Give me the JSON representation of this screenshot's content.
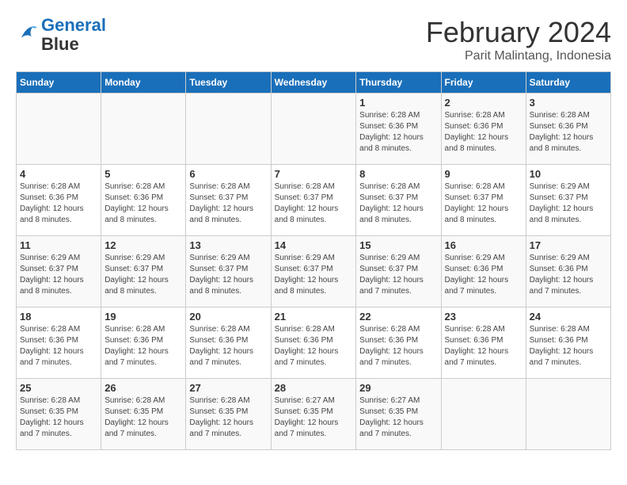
{
  "logo": {
    "line1": "General",
    "line2": "Blue"
  },
  "title": "February 2024",
  "subtitle": "Parit Malintang, Indonesia",
  "weekdays": [
    "Sunday",
    "Monday",
    "Tuesday",
    "Wednesday",
    "Thursday",
    "Friday",
    "Saturday"
  ],
  "weeks": [
    [
      {
        "day": "",
        "info": ""
      },
      {
        "day": "",
        "info": ""
      },
      {
        "day": "",
        "info": ""
      },
      {
        "day": "",
        "info": ""
      },
      {
        "day": "1",
        "info": "Sunrise: 6:28 AM\nSunset: 6:36 PM\nDaylight: 12 hours and 8 minutes."
      },
      {
        "day": "2",
        "info": "Sunrise: 6:28 AM\nSunset: 6:36 PM\nDaylight: 12 hours and 8 minutes."
      },
      {
        "day": "3",
        "info": "Sunrise: 6:28 AM\nSunset: 6:36 PM\nDaylight: 12 hours and 8 minutes."
      }
    ],
    [
      {
        "day": "4",
        "info": "Sunrise: 6:28 AM\nSunset: 6:36 PM\nDaylight: 12 hours and 8 minutes."
      },
      {
        "day": "5",
        "info": "Sunrise: 6:28 AM\nSunset: 6:36 PM\nDaylight: 12 hours and 8 minutes."
      },
      {
        "day": "6",
        "info": "Sunrise: 6:28 AM\nSunset: 6:37 PM\nDaylight: 12 hours and 8 minutes."
      },
      {
        "day": "7",
        "info": "Sunrise: 6:28 AM\nSunset: 6:37 PM\nDaylight: 12 hours and 8 minutes."
      },
      {
        "day": "8",
        "info": "Sunrise: 6:28 AM\nSunset: 6:37 PM\nDaylight: 12 hours and 8 minutes."
      },
      {
        "day": "9",
        "info": "Sunrise: 6:28 AM\nSunset: 6:37 PM\nDaylight: 12 hours and 8 minutes."
      },
      {
        "day": "10",
        "info": "Sunrise: 6:29 AM\nSunset: 6:37 PM\nDaylight: 12 hours and 8 minutes."
      }
    ],
    [
      {
        "day": "11",
        "info": "Sunrise: 6:29 AM\nSunset: 6:37 PM\nDaylight: 12 hours and 8 minutes."
      },
      {
        "day": "12",
        "info": "Sunrise: 6:29 AM\nSunset: 6:37 PM\nDaylight: 12 hours and 8 minutes."
      },
      {
        "day": "13",
        "info": "Sunrise: 6:29 AM\nSunset: 6:37 PM\nDaylight: 12 hours and 8 minutes."
      },
      {
        "day": "14",
        "info": "Sunrise: 6:29 AM\nSunset: 6:37 PM\nDaylight: 12 hours and 8 minutes."
      },
      {
        "day": "15",
        "info": "Sunrise: 6:29 AM\nSunset: 6:37 PM\nDaylight: 12 hours and 7 minutes."
      },
      {
        "day": "16",
        "info": "Sunrise: 6:29 AM\nSunset: 6:36 PM\nDaylight: 12 hours and 7 minutes."
      },
      {
        "day": "17",
        "info": "Sunrise: 6:29 AM\nSunset: 6:36 PM\nDaylight: 12 hours and 7 minutes."
      }
    ],
    [
      {
        "day": "18",
        "info": "Sunrise: 6:28 AM\nSunset: 6:36 PM\nDaylight: 12 hours and 7 minutes."
      },
      {
        "day": "19",
        "info": "Sunrise: 6:28 AM\nSunset: 6:36 PM\nDaylight: 12 hours and 7 minutes."
      },
      {
        "day": "20",
        "info": "Sunrise: 6:28 AM\nSunset: 6:36 PM\nDaylight: 12 hours and 7 minutes."
      },
      {
        "day": "21",
        "info": "Sunrise: 6:28 AM\nSunset: 6:36 PM\nDaylight: 12 hours and 7 minutes."
      },
      {
        "day": "22",
        "info": "Sunrise: 6:28 AM\nSunset: 6:36 PM\nDaylight: 12 hours and 7 minutes."
      },
      {
        "day": "23",
        "info": "Sunrise: 6:28 AM\nSunset: 6:36 PM\nDaylight: 12 hours and 7 minutes."
      },
      {
        "day": "24",
        "info": "Sunrise: 6:28 AM\nSunset: 6:36 PM\nDaylight: 12 hours and 7 minutes."
      }
    ],
    [
      {
        "day": "25",
        "info": "Sunrise: 6:28 AM\nSunset: 6:35 PM\nDaylight: 12 hours and 7 minutes."
      },
      {
        "day": "26",
        "info": "Sunrise: 6:28 AM\nSunset: 6:35 PM\nDaylight: 12 hours and 7 minutes."
      },
      {
        "day": "27",
        "info": "Sunrise: 6:28 AM\nSunset: 6:35 PM\nDaylight: 12 hours and 7 minutes."
      },
      {
        "day": "28",
        "info": "Sunrise: 6:27 AM\nSunset: 6:35 PM\nDaylight: 12 hours and 7 minutes."
      },
      {
        "day": "29",
        "info": "Sunrise: 6:27 AM\nSunset: 6:35 PM\nDaylight: 12 hours and 7 minutes."
      },
      {
        "day": "",
        "info": ""
      },
      {
        "day": "",
        "info": ""
      }
    ]
  ]
}
